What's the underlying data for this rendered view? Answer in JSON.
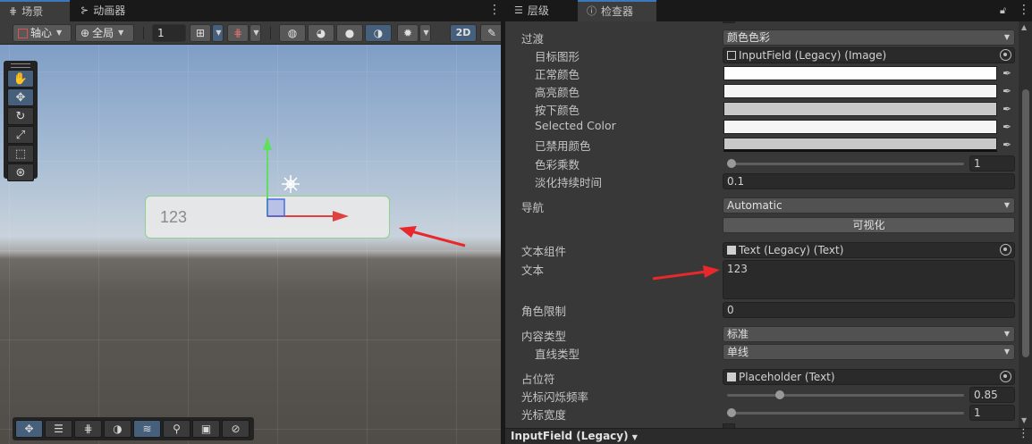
{
  "scene": {
    "tabs": [
      {
        "label": "场景",
        "icon": "grid-icon"
      },
      {
        "label": "动画器",
        "icon": "animator-icon"
      }
    ],
    "toolbar": {
      "pivot_label": "轴心",
      "global_label": "全局",
      "grid_value": "1",
      "mode_2d_label": "2D"
    },
    "canvas_text": "123"
  },
  "inspector": {
    "tabs": [
      {
        "label": "层级",
        "icon": "hierarchy-icon"
      },
      {
        "label": "检查器",
        "icon": "info-icon"
      }
    ],
    "transition": {
      "label": "过渡",
      "value": "颜色色彩"
    },
    "target_graphic": {
      "label": "目标图形",
      "value": "InputField (Legacy) (Image)"
    },
    "normal_color": {
      "label": "正常颜色",
      "color": "#ffffff"
    },
    "highlighted_color": {
      "label": "高亮颜色",
      "color": "#f5f5f5"
    },
    "pressed_color": {
      "label": "按下颜色",
      "color": "#c8c8c8"
    },
    "selected_color": {
      "label": "Selected Color",
      "color": "#f5f5f5"
    },
    "disabled_color": {
      "label": "已禁用颜色",
      "color": "#c8c8c8"
    },
    "color_multiplier": {
      "label": "色彩乘数",
      "value": "1",
      "fraction": 0
    },
    "fade_duration": {
      "label": "淡化持续时间",
      "value": "0.1"
    },
    "navigation": {
      "label": "导航",
      "value": "Automatic",
      "visualize_label": "可视化"
    },
    "text_component": {
      "label": "文本组件",
      "value": "Text (Legacy) (Text)"
    },
    "text": {
      "label": "文本",
      "value": "123"
    },
    "character_limit": {
      "label": "角色限制",
      "value": "0"
    },
    "content_type": {
      "label": "内容类型",
      "value": "标准"
    },
    "line_type": {
      "label": "直线类型",
      "value": "单线"
    },
    "placeholder": {
      "label": "占位符",
      "value": "Placeholder (Text)"
    },
    "caret_blink_rate": {
      "label": "光标闪烁频率",
      "value": "0.85",
      "fraction": 0.2125
    },
    "caret_width": {
      "label": "光标宽度",
      "value": "1",
      "fraction": 0
    },
    "footer": {
      "label": "InputField (Legacy)"
    }
  }
}
